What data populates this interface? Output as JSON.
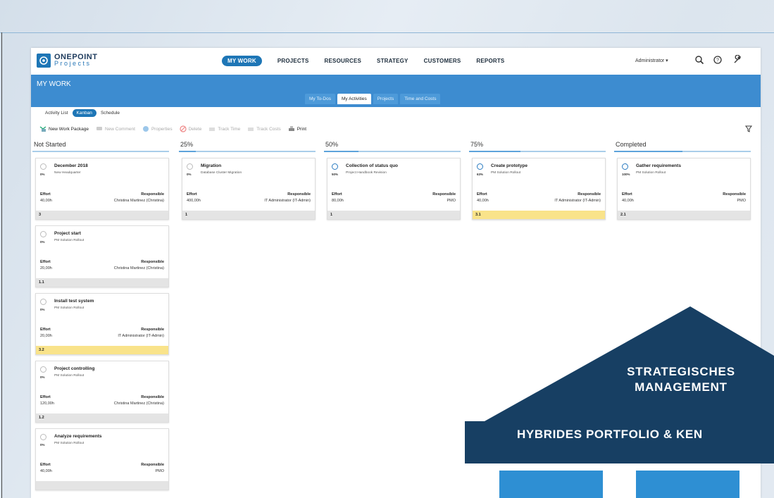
{
  "app": {
    "logo_line1": "ONEPOINT",
    "logo_line2": "Projects"
  },
  "nav": {
    "items": [
      "MY WORK",
      "PROJECTS",
      "RESOURCES",
      "STRATEGY",
      "CUSTOMERS",
      "REPORTS"
    ],
    "active": "MY WORK",
    "user_menu": "Administrator",
    "icons": [
      "search-icon",
      "help-icon",
      "wrench-icon"
    ]
  },
  "page": {
    "title": "MY WORK",
    "tabs": [
      "My To-Dos",
      "My Activities",
      "Projects",
      "Time and Costs"
    ],
    "active_tab": "My Activities",
    "subtabs": [
      "Activity List",
      "Kanban",
      "Schedule"
    ],
    "active_subtab": "Kanban"
  },
  "toolbar": {
    "new_work_package": "New Work Package",
    "new_comment": "New Comment",
    "properties": "Properties",
    "delete": "Delete",
    "track_time": "Track Time",
    "track_costs": "Track Costs",
    "print": "Print"
  },
  "labels": {
    "effort": "Effort",
    "responsible": "Responsible"
  },
  "columns": [
    {
      "title": "Not Started",
      "progress": 0,
      "cards": [
        {
          "name": "December 2018",
          "pct": "0%",
          "project": "New Headquarter",
          "effort": "40,00h",
          "responsible": "Christina Martinez (Christina)",
          "wbs": "3",
          "highlight": false
        },
        {
          "name": "Project start",
          "pct": "0%",
          "project": "PM Solution Rollout",
          "effort": "20,00h",
          "responsible": "Christina Martinez (Christina)",
          "wbs": "1.1",
          "highlight": false
        },
        {
          "name": "Install test system",
          "pct": "0%",
          "project": "PM Solution Rollout",
          "effort": "20,00h",
          "responsible": "IT Administrator (IT-Admin)",
          "wbs": "3.2",
          "highlight": true
        },
        {
          "name": "Project controlling",
          "pct": "0%",
          "project": "PM Solution Rollout",
          "effort": "120,00h",
          "responsible": "Christina Martinez (Christina)",
          "wbs": "1.2",
          "highlight": false
        },
        {
          "name": "Analyze requirements",
          "pct": "0%",
          "project": "PM Solution Rollout",
          "effort": "40,00h",
          "responsible": "PMO",
          "wbs": "",
          "highlight": false
        }
      ]
    },
    {
      "title": "25%",
      "progress": 0.25,
      "cards": [
        {
          "name": "Migration",
          "pct": "0%",
          "project": "Database Cluster Migration",
          "effort": "400,00h",
          "responsible": "IT Administrator (IT-Admin)",
          "wbs": "1",
          "highlight": false
        }
      ]
    },
    {
      "title": "50%",
      "progress": 0.5,
      "cards": [
        {
          "name": "Collection of status quo",
          "pct": "50%",
          "project": "Project Handbook Revision",
          "effort": "80,00h",
          "responsible": "PMO",
          "wbs": "1",
          "highlight": false
        }
      ]
    },
    {
      "title": "75%",
      "progress": 0.75,
      "cards": [
        {
          "name": "Create prototype",
          "pct": "63%",
          "project": "PM Solution Rollout",
          "effort": "40,00h",
          "responsible": "IT Administrator (IT-Admin)",
          "wbs": "3.1",
          "highlight": true
        }
      ]
    },
    {
      "title": "Completed",
      "progress": 1,
      "cards": [
        {
          "name": "Gather requirements",
          "pct": "100%",
          "project": "PM Solution Rollout",
          "effort": "40,00h",
          "responsible": "PMO",
          "wbs": "2.1",
          "highlight": false
        }
      ]
    }
  ],
  "overlay": {
    "roof_text": "STRATEGISCHES MANAGEMENT",
    "beam_text": "HYBRIDES PORTFOLIO & KEN",
    "colors": {
      "dark": "#173f63",
      "light": "#2e8fd3"
    }
  }
}
